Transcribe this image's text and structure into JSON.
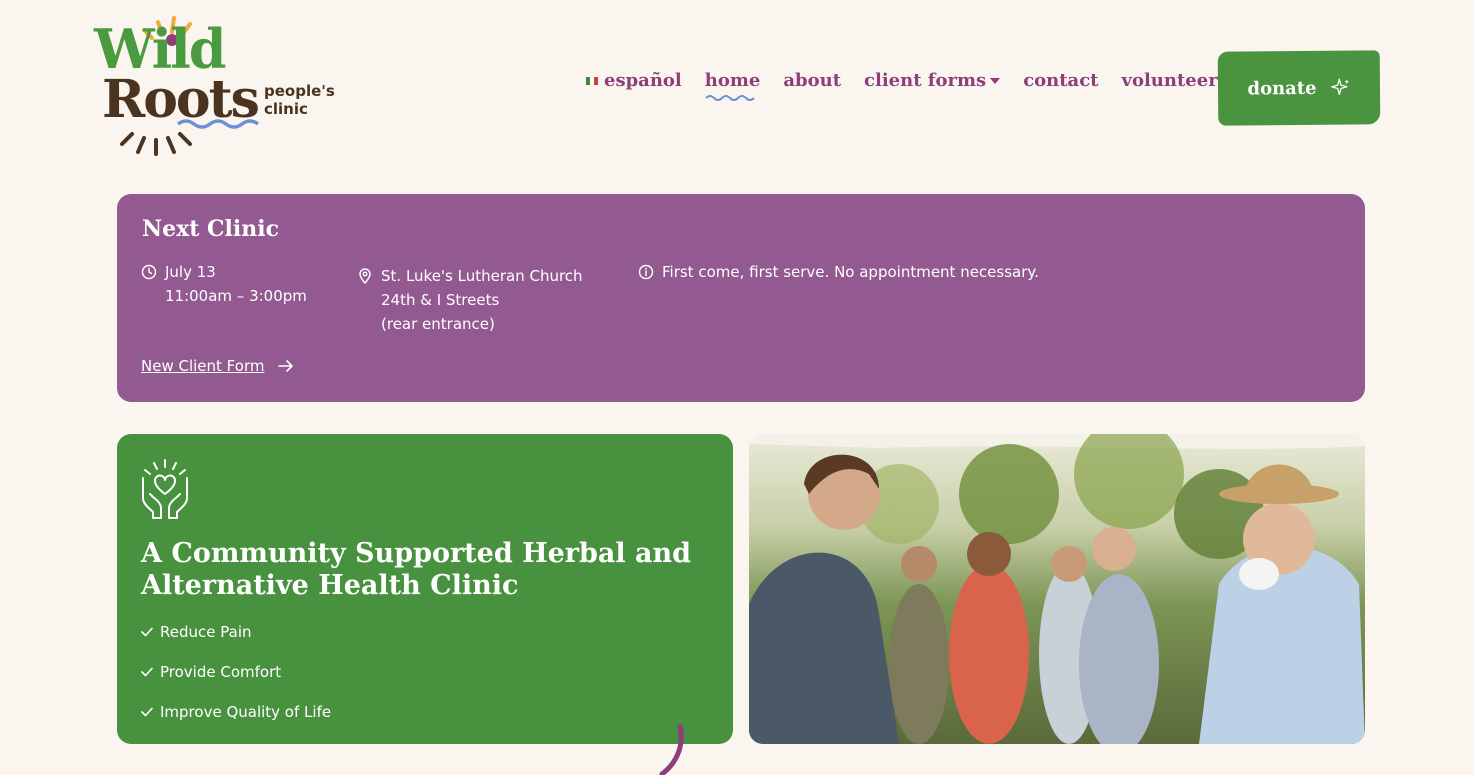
{
  "logo": {
    "word1": "Wild",
    "word2": "Roots",
    "tagline": "people's clinic"
  },
  "nav": {
    "items": [
      {
        "label": "español"
      },
      {
        "label": "home"
      },
      {
        "label": "about"
      },
      {
        "label": "client forms"
      },
      {
        "label": "contact"
      },
      {
        "label": "volunteer"
      }
    ],
    "donate_label": "donate"
  },
  "next_clinic": {
    "title": "Next Clinic",
    "date": "July 13",
    "time": "11:00am – 3:00pm",
    "location_line1": "St. Luke's Lutheran Church",
    "location_line2": "24th & I Streets",
    "location_line3": "(rear entrance)",
    "note": "First come, first serve. No appointment necessary.",
    "form_link": "New Client Form"
  },
  "hero": {
    "title": "A Community Supported Herbal and Alternative Health Clinic",
    "bullets": [
      "Reduce Pain",
      "Provide Comfort",
      "Improve Quality of Life"
    ]
  },
  "colors": {
    "background": "#faf6ef",
    "purple": "#935a91",
    "green": "#47913f",
    "nav_text": "#8f3e7c",
    "brown": "#4a3420"
  },
  "icons": {
    "date": "clock-icon",
    "location": "map-pin-icon",
    "note": "info-icon",
    "link": "arrow-right-icon",
    "donate": "sparkle-icon",
    "hero": "heart-hands-icon",
    "bullet": "check-icon"
  }
}
